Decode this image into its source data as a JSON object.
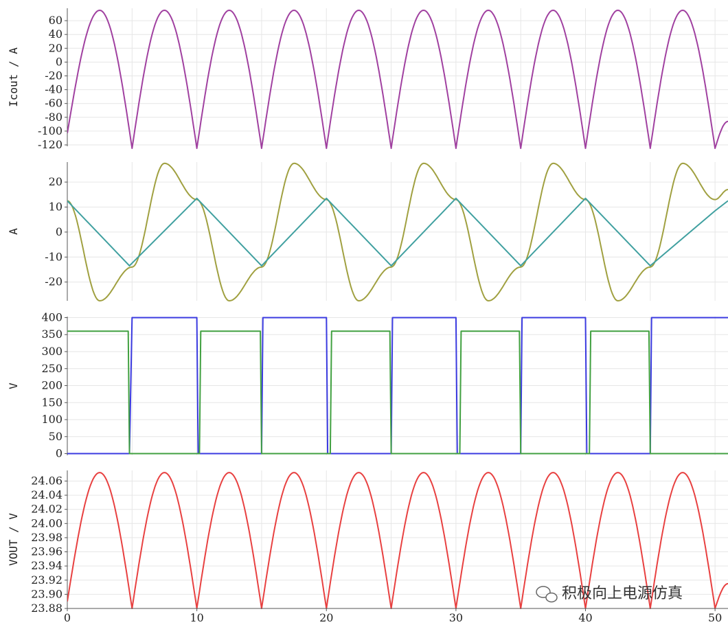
{
  "chart_data": [
    {
      "type": "line",
      "id": "p1",
      "ylabel": "Icout / A",
      "xlim": [
        0,
        51
      ],
      "ylim": [
        -122,
        78
      ],
      "yticks": [
        60,
        40,
        20,
        0,
        -20,
        -40,
        -60,
        -80,
        -100,
        -120
      ],
      "ytick_labels": [
        "60",
        "40",
        "20",
        "0",
        "-20",
        "-40",
        "-60",
        "-80",
        "-100",
        "-120"
      ],
      "series": [
        {
          "color": "#a040a0",
          "shape": "rectified_sine",
          "x": [
            0,
            2.5,
            5,
            7.5,
            10,
            12.5,
            15,
            17.5,
            20,
            22.5,
            25,
            27.5,
            30,
            32.5,
            35,
            37.5,
            40,
            42.5,
            45,
            47.5,
            50,
            51
          ],
          "y": [
            -103,
            75,
            -125,
            75,
            -125,
            75,
            -125,
            75,
            -125,
            75,
            -125,
            75,
            -125,
            75,
            -125,
            75,
            -125,
            75,
            -125,
            75,
            -125,
            -86
          ]
        }
      ]
    },
    {
      "type": "line",
      "id": "p2",
      "ylabel": "A",
      "xlim": [
        0,
        51
      ],
      "ylim": [
        -27.5,
        28
      ],
      "yticks": [
        20,
        10,
        0,
        -10,
        -20
      ],
      "ytick_labels": [
        "20",
        "10",
        "0",
        "-10",
        "-20"
      ],
      "series": [
        {
          "color": "#a0a040",
          "shape": "sine",
          "x": [
            0,
            2.5,
            5,
            7.5,
            10,
            12.5,
            15,
            17.5,
            20,
            22.5,
            25,
            27.5,
            30,
            32.5,
            35,
            37.5,
            40,
            42.5,
            45,
            47.5,
            50,
            51
          ],
          "y": [
            12.5,
            -27.5,
            -14,
            27.5,
            13,
            -27.5,
            -14,
            27.5,
            13,
            -27.5,
            -14,
            27.5,
            13,
            -27.5,
            -14,
            27.5,
            13,
            -27.5,
            -14,
            27.5,
            13,
            17
          ]
        },
        {
          "color": "#40a0a0",
          "shape": "triangle",
          "x": [
            0,
            4.8,
            10,
            15,
            20,
            25,
            30,
            35,
            40,
            45,
            50,
            51
          ],
          "y": [
            12.5,
            -13.5,
            13.5,
            -13.5,
            13.5,
            -13.5,
            13.5,
            -13.5,
            13.5,
            -13.5,
            8.5,
            12.5
          ]
        }
      ]
    },
    {
      "type": "line",
      "id": "p3",
      "ylabel": "V",
      "xlim": [
        0,
        51
      ],
      "ylim": [
        -5,
        403
      ],
      "yticks": [
        400,
        350,
        300,
        250,
        200,
        150,
        100,
        50,
        0
      ],
      "ytick_labels": [
        "400",
        "350",
        "300",
        "250",
        "200",
        "150",
        "100",
        "50",
        "0"
      ],
      "series": [
        {
          "color": "#3a3ae0",
          "shape": "square",
          "x": [
            0,
            4.8,
            5,
            10,
            10.1,
            15,
            15.1,
            20,
            20.1,
            25,
            25.1,
            30,
            30.1,
            35,
            35.1,
            40,
            40.1,
            45,
            45.1,
            51
          ],
          "y": [
            0,
            0,
            400,
            400,
            0,
            0,
            400,
            400,
            0,
            0,
            400,
            400,
            0,
            0,
            400,
            400,
            0,
            0,
            400,
            400
          ]
        },
        {
          "color": "#40a040",
          "shape": "square",
          "x": [
            0,
            4.7,
            4.8,
            10.2,
            10.3,
            14.9,
            15,
            20.3,
            20.4,
            24.9,
            25,
            30.3,
            30.4,
            34.9,
            35,
            40.3,
            40.4,
            44.9,
            45,
            51
          ],
          "y": [
            360,
            360,
            0,
            0,
            360,
            360,
            0,
            0,
            360,
            360,
            0,
            0,
            360,
            360,
            0,
            0,
            360,
            360,
            0,
            0
          ]
        }
      ]
    },
    {
      "type": "line",
      "id": "p4",
      "ylabel": "VOUT / V",
      "xlim": [
        0,
        51
      ],
      "ylim": [
        23.88,
        24.075
      ],
      "yticks": [
        24.06,
        24.04,
        24.02,
        24.0,
        23.98,
        23.96,
        23.94,
        23.92,
        23.9,
        23.88
      ],
      "ytick_labels": [
        "24.06",
        "24.04",
        "24.02",
        "24.00",
        "23.98",
        "23.96",
        "23.94",
        "23.92",
        "23.90",
        "23.88"
      ],
      "xticks": [
        0,
        10,
        20,
        30,
        40,
        50
      ],
      "xtick_labels": [
        "0",
        "10",
        "20",
        "30",
        "40",
        "50"
      ],
      "series": [
        {
          "color": "#e84040",
          "shape": "rectified_sine",
          "x": [
            0,
            2.5,
            5,
            7.5,
            10,
            12.5,
            15,
            17.5,
            20,
            22.5,
            25,
            27.5,
            30,
            32.5,
            35,
            37.5,
            40,
            42.5,
            45,
            47.5,
            50,
            51
          ],
          "y": [
            23.89,
            24.072,
            23.88,
            24.072,
            23.88,
            24.072,
            23.88,
            24.072,
            23.88,
            24.072,
            23.88,
            24.072,
            23.88,
            24.072,
            23.88,
            24.072,
            23.88,
            24.072,
            23.88,
            24.072,
            23.88,
            23.915
          ]
        }
      ]
    }
  ],
  "watermark": "积极向上电源仿真",
  "colors": {
    "grid": "#e6e6e6",
    "axis": "#555555",
    "background": "#ffffff"
  }
}
